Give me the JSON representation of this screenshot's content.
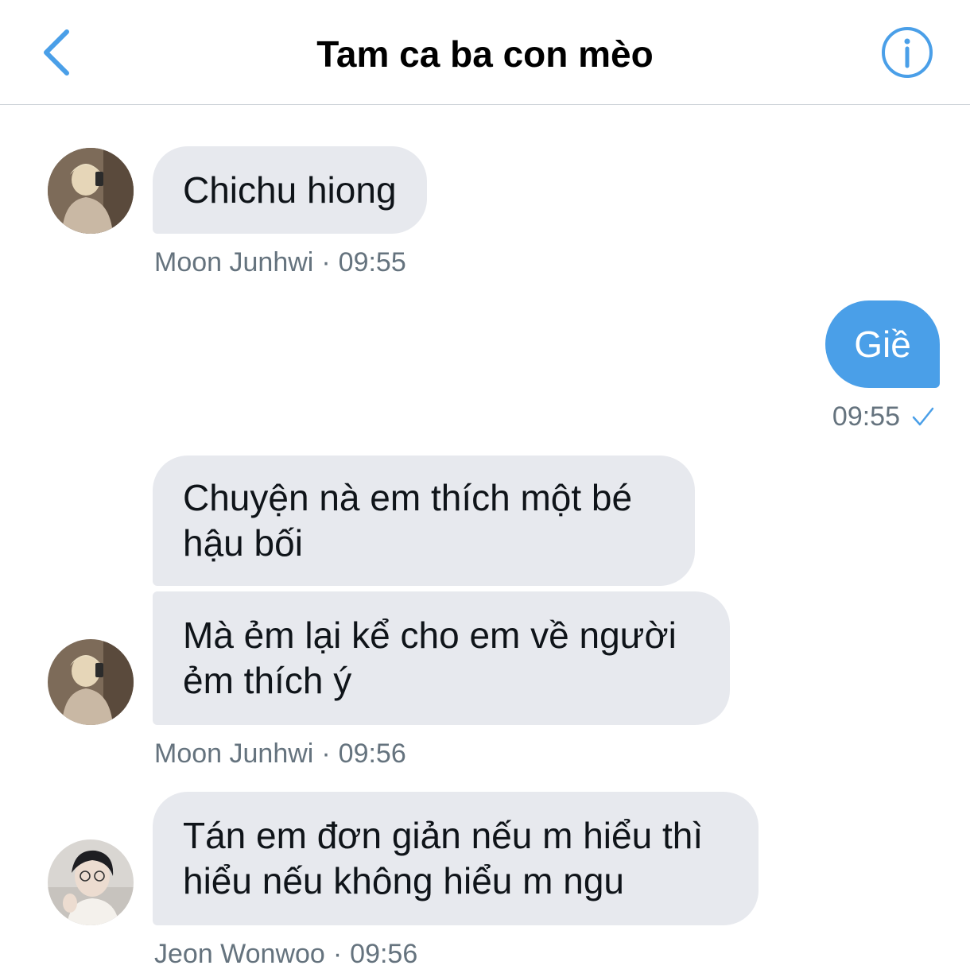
{
  "header": {
    "title": "Tam ca ba con mèo",
    "back_icon": "chevron-left-icon",
    "info_icon": "info-circle-icon",
    "accent_color": "#4a9fe8"
  },
  "messages": [
    {
      "direction": "incoming",
      "sender": "Moon Junhwi",
      "bubbles": [
        "Chichu hiong"
      ],
      "time": "09:55"
    },
    {
      "direction": "outgoing",
      "bubbles": [
        "Giề"
      ],
      "time": "09:55",
      "status_icon": "checkmark-icon"
    },
    {
      "direction": "incoming",
      "sender": "Moon Junhwi",
      "bubbles": [
        "Chuyện nà em thích một bé hậu bối",
        "Mà ẻm lại kể cho em về người ẻm thích ý"
      ],
      "time": "09:56"
    },
    {
      "direction": "incoming",
      "sender": "Jeon Wonwoo",
      "bubbles": [
        "Tán em đơn giản nếu m hiểu thì hiểu nếu không hiểu m ngu"
      ],
      "time": "09:56"
    }
  ],
  "colors": {
    "incoming_bubble": "#e7e9ee",
    "outgoing_bubble": "#4a9fe8",
    "meta_text": "#65737e"
  }
}
